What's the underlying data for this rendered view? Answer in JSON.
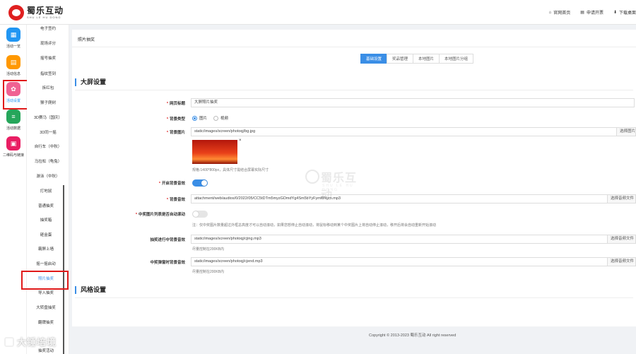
{
  "brand": {
    "name_cn": "蜀乐互动",
    "name_en": "SHU LE HU DONG",
    "color": "#e02020"
  },
  "topnav": [
    {
      "label": "官网首页",
      "icon": "home-icon"
    },
    {
      "label": "申请开票",
      "icon": "invoice-icon"
    },
    {
      "label": "下载桌面",
      "icon": "download-icon"
    }
  ],
  "rail": [
    {
      "label": "活动一览",
      "icon": "grid-icon",
      "color": "#2196f3"
    },
    {
      "label": "活动信息",
      "icon": "document-icon",
      "color": "#ff9800"
    },
    {
      "label": "活动设置",
      "icon": "gear-icon",
      "color": "#f06292"
    },
    {
      "label": "活动数据",
      "icon": "database-icon",
      "color": "#26a65b"
    },
    {
      "label": "二维码与链接",
      "icon": "qrcode-icon",
      "color": "#e91e63"
    }
  ],
  "submenu": [
    "电子签约",
    "现场评分",
    "摇号抽奖",
    "指纹签到",
    "拆红包",
    "猴子爬树",
    "3D赛马（国庆）",
    "3D同一摇",
    "自行车（中秋）",
    "马拉松（龟兔）",
    "游泳（中秋）",
    "打地鼠",
    "普通抽奖",
    "抽奖箱",
    "砸金蛋",
    "霸屏上墙",
    "摇一摇启动",
    "照片抽奖",
    "导入抽奖",
    "大转盘抽奖",
    "翻牌抽奖",
    "抽奖活动"
  ],
  "page": {
    "title": "照片抽奖"
  },
  "tabs": [
    "基础设置",
    "奖品管理",
    "本地图片",
    "本地图片分组"
  ],
  "sections": {
    "big_screen": "大屏设置",
    "style": "风格设置"
  },
  "form": {
    "page_title": {
      "label": "网页标题",
      "value": "大屏照片抽奖"
    },
    "bg_type": {
      "label": "背景类型",
      "options": [
        "图片",
        "视频"
      ],
      "selected": "图片"
    },
    "bg_image": {
      "label": "背景图片",
      "value": "static/images/screen/photoqj/bg.jpg",
      "button": "选择图片",
      "hint": "规格:1400*800px，具体尺寸需结合屏幕实际尺寸"
    },
    "bg_music_enable": {
      "label": "开启背景音效",
      "on": true
    },
    "bg_music": {
      "label": "背景音效",
      "value": "attachment/web/audios/0/2022/05/CC5tDTm5myzGDmdYg4Sm5bYyFymf8Nym.mp3",
      "button": "选择音频文件"
    },
    "auto_scroll": {
      "label": "中奖图片列表是否自动滚动",
      "on": false,
      "hint": "注：仅中奖图片数量超过外框总高度才可以自动滚动，如果您想停止自动滚动，将鼠标移动到某个中奖图片上将自动停止滚动，移开后将会自动重新开始滚动"
    },
    "drawing_music": {
      "label": "抽奖进行中背景音效",
      "value": "static/images/screen/photoqj/cjing.mp3",
      "button": "选择音频文件",
      "hint": "尽量控制在200KB内"
    },
    "winning_music": {
      "label": "中奖弹窗时背景音效",
      "value": "static/images/screen/photoqj/cjend.mp3",
      "button": "选择音频文件",
      "hint": "尽量控制在200KB内"
    }
  },
  "footer": "Copyright © 2013-2023 蜀乐互动 All right reserved",
  "overlay_watermark": {
    "text_cn": "蜀乐互动",
    "text_en": "SHU LE HU DONG"
  },
  "corner_watermark": "大锤培境",
  "colors": {
    "accent": "#3a8ee6",
    "highlight_box": "#e01a1a"
  }
}
